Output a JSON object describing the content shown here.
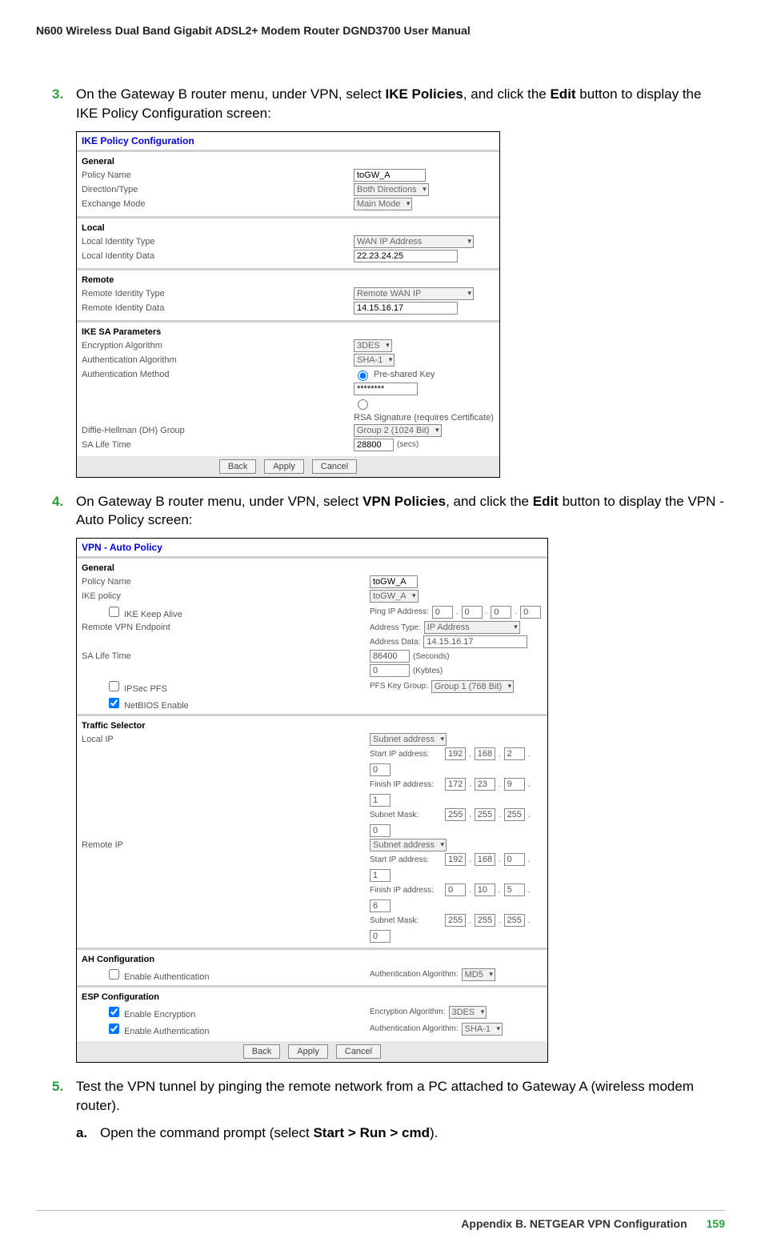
{
  "doc_header": "N600 Wireless Dual Band Gigabit ADSL2+ Modem Router DGND3700 User Manual",
  "step3": {
    "num": "3.",
    "line1": "On the Gateway B router menu, under VPN, select ",
    "b1": "IKE Policies",
    "mid": ", and click the ",
    "b2": "Edit",
    "line2": " button to display the IKE Policy Configuration screen:"
  },
  "ike": {
    "title": "IKE Policy Configuration",
    "general": "General",
    "policy_name_lbl": "Policy Name",
    "policy_name_val": "toGW_A",
    "direction_lbl": "Direction/Type",
    "direction_val": "Both Directions",
    "exchange_lbl": "Exchange Mode",
    "exchange_val": "Main Mode",
    "local": "Local",
    "local_id_type_lbl": "Local Identity Type",
    "local_id_type_val": "WAN IP Address",
    "local_id_data_lbl": "Local Identity Data",
    "local_id_data_val": "22.23.24.25",
    "remote": "Remote",
    "remote_id_type_lbl": "Remote Identity Type",
    "remote_id_type_val": "Remote WAN IP",
    "remote_id_data_lbl": "Remote Identity Data",
    "remote_id_data_val": "14.15.16.17",
    "sa": "IKE SA Parameters",
    "enc_lbl": "Encryption Algorithm",
    "enc_val": "3DES",
    "auth_alg_lbl": "Authentication Algorithm",
    "auth_alg_val": "SHA-1",
    "auth_meth_lbl": "Authentication Method",
    "psk_label": "Pre-shared Key",
    "psk_val": "********",
    "rsa_label": "RSA Signature (requires Certificate)",
    "dh_lbl": "Diffie-Hellman (DH) Group",
    "dh_val": "Group 2 (1024 Bit)",
    "sa_life_lbl": "SA Life Time",
    "sa_life_val": "28800",
    "sa_life_unit": "(secs)",
    "buttons": {
      "back": "Back",
      "apply": "Apply",
      "cancel": "Cancel"
    }
  },
  "step4": {
    "num": "4.",
    "line1": "On Gateway B router menu, under VPN, select ",
    "b1": "VPN Policies",
    "mid": ", and click the ",
    "b2": "Edit",
    "line2": " button to display the VPN - Auto Policy screen:"
  },
  "vpn": {
    "title": "VPN - Auto Policy",
    "general": "General",
    "policy_name_lbl": "Policy Name",
    "policy_name_val": "toGW_A",
    "ike_policy_lbl": "IKE policy",
    "ike_policy_val": "toGW_A",
    "ike_keep_alive_lbl": "IKE Keep Alive",
    "ping_ip_lbl": "Ping IP Address:",
    "ping_ip": [
      "0",
      "0",
      "0",
      "0"
    ],
    "remote_ep_lbl": "Remote VPN Endpoint",
    "addr_type_lbl": "Address Type:",
    "addr_type_val": "IP Address",
    "addr_data_lbl": "Address Data:",
    "addr_data_val": "14.15.16.17",
    "sa_life_lbl": "SA Life Time",
    "sa_life_sec_val": "86400",
    "sa_life_sec_unit": "(Seconds)",
    "sa_life_kb_val": "0",
    "sa_life_kb_unit": "(Kybtes)",
    "ipsec_pfs_lbl": "IPSec PFS",
    "pfs_group_lbl": "PFS Key Group:",
    "pfs_group_val": "Group 1 (768 Bit)",
    "netbios_lbl": "NetBIOS Enable",
    "traffic": "Traffic Selector",
    "local_ip_lbl": "Local IP",
    "subnet_addr": "Subnet address",
    "start_ip_lbl": "Start IP address:",
    "finish_ip_lbl": "Finish IP address:",
    "subnet_mask_lbl": "Subnet Mask:",
    "local_start": [
      "192",
      "168",
      "2",
      "0"
    ],
    "local_finish": [
      "172",
      "23",
      "9",
      "1"
    ],
    "local_mask": [
      "255",
      "255",
      "255",
      "0"
    ],
    "remote_ip_lbl": "Remote IP",
    "remote_start": [
      "192",
      "168",
      "0",
      "1"
    ],
    "remote_finish": [
      "0",
      "10",
      "5",
      "6"
    ],
    "remote_mask": [
      "255",
      "255",
      "255",
      "0"
    ],
    "ah": "AH Configuration",
    "ah_enable_lbl": "Enable Authentication",
    "auth_alg2_lbl": "Authentication Algorithm:",
    "auth_alg2_val": "MD5",
    "esp": "ESP Configuration",
    "esp_enc_lbl": "Enable Encryption",
    "esp_enc_alg_lbl": "Encryption Algorithm:",
    "esp_enc_alg_val": "3DES",
    "esp_auth_lbl": "Enable Authentication",
    "esp_auth_alg_lbl": "Authentication Algorithm:",
    "esp_auth_alg_val": "SHA-1",
    "buttons": {
      "back": "Back",
      "apply": "Apply",
      "cancel": "Cancel"
    }
  },
  "step5": {
    "num": "5.",
    "text": "Test the VPN tunnel by pinging the remote network from a PC attached to Gateway A (wireless modem router)."
  },
  "step5a": {
    "num": "a.",
    "pre": "Open the command prompt (select ",
    "b1": "Start > Run > cmd",
    "post": ")."
  },
  "footer": {
    "appendix": "Appendix B.  NETGEAR VPN Configuration",
    "page": "159"
  }
}
